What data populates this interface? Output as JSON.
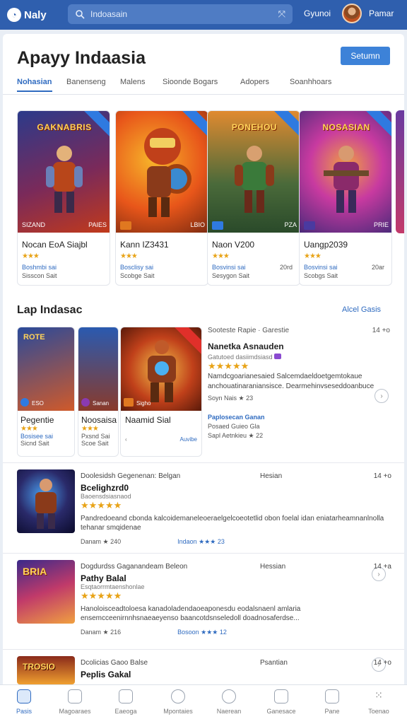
{
  "topbar": {
    "logo": "Naly",
    "search_query": "Indoasain",
    "link": "Gyunoi",
    "user": "Pamar"
  },
  "header": {
    "title": "Apayy Indaasia",
    "button": "Setumn"
  },
  "tabs": [
    {
      "label": "Nohasian"
    },
    {
      "label": "Banenseng"
    },
    {
      "label": "Malens"
    },
    {
      "label": "Sioonde Bogars"
    },
    {
      "label": "Adopers"
    },
    {
      "label": "Soanhhoars"
    }
  ],
  "featured": [
    {
      "art": "GAKNABRIS",
      "name": "Nocan EoA Siajbl",
      "rating": "★★★",
      "meta1": "Boshmbi sai",
      "meta2": "Sisscon Sait",
      "badge_left": "SIZAND",
      "badge_right": "PAIES",
      "colors": [
        "#2b3a8a",
        "#c23a1a",
        "#f2a23a"
      ]
    },
    {
      "art": "",
      "name": "Kann IZ3431",
      "rating": "★★★",
      "meta1": "Bosclisy sai",
      "meta2": "Scobge Sait",
      "badge_left": "",
      "badge_right": "LBIO",
      "colors": [
        "#e8561a",
        "#f7b52a",
        "#7a2a10"
      ]
    },
    {
      "art": "PONEHOU",
      "name": "Naon V200",
      "rating": "★★★",
      "meta1": "Bosvinsi sai",
      "meta2": "Sesygon Sait",
      "badge_left": "",
      "badge_right": "PZA",
      "meta_right": "20rd",
      "colors": [
        "#3a6a3a",
        "#f0b030",
        "#a04020"
      ]
    },
    {
      "art": "NOSASIAN",
      "name": "Uangp2039",
      "rating": "★★★",
      "meta1": "Bosvinsi sai",
      "meta2": "Scobgs Sait",
      "badge_left": "",
      "badge_right": "PRIE",
      "meta_right": "20ar",
      "colors": [
        "#4a2a7a",
        "#c83aa0",
        "#f0a040"
      ]
    }
  ],
  "section": {
    "title": "Lap Indasac",
    "link": "Alcel Gasis"
  },
  "mid_cards": [
    {
      "name": "Pegentie",
      "rating": "★★★",
      "meta1": "Bosisee sai",
      "meta2": "Sicnd Sait",
      "badge": "ESO"
    },
    {
      "name": "Noosaisa",
      "rating": "★★★",
      "meta1": "Pxsnd Sai",
      "meta2": "Scoe Sait",
      "badge": "Sanan"
    },
    {
      "name": "Naamid Sial",
      "badge": "Sigho",
      "extra": "Auvibe"
    }
  ],
  "detail": {
    "dev": "Sooteste Rapie",
    "dev_right": "Garestie",
    "time": "14 +o",
    "name": "Nanetka Asnauden",
    "sub": "Gatutoed dasiimdsiasd",
    "rating": "★★★★★",
    "desc": "Namdcgoarianesaied Salcemdaeldoetgemtokaue anchouatinaraniansisce. Dearmehinvseseddoanbuce",
    "rating_line": "Soyn Nais ★ 23",
    "link": "Paplosecan Ganan",
    "link2": "Posaed Guieo Gla",
    "foot": "Sapl Aetnkieu ★ 22"
  },
  "list": [
    {
      "dev": "Doolesidsh Gegenenan: Belgan",
      "dev_right": "Hesian",
      "time": "14 +o",
      "name": "Bcelighzrd0",
      "sub": "Baoensdsiasnaod",
      "rating": "★★★★★",
      "desc": "Pandredoeand cbonda kalcoidemaneleoeraelgelcoeotetlid obon foelal idan eniatarheamnanlnolla tehanar smqidenae",
      "meta": "Danam ★ 240",
      "meta_right": "Indaon ★★★ 23"
    },
    {
      "dev": "Dogdurdss Gaganandeam Beleon",
      "dev_right": "Hessian",
      "time": "14 +a",
      "name": "Pathy Balal",
      "sub": "Esqtaorrmtaenshonlae",
      "rating": "★★★★★",
      "desc": "Hanoloisceadtoloesa kanadoladendaoeaponesdu eodalsnaenl amlaria ensemcceenirnnhsnaeaeyenso baancotdsnseledoll doadnosaferdse...",
      "meta": "Danam ★ 216",
      "meta_right": "Bosoon ★★★ 12"
    },
    {
      "dev": "Dcolicias Gaoo Balse",
      "dev_right": "Psantian",
      "time": "14 +o",
      "name": "Peplis Gakal",
      "sub": "",
      "rating": "",
      "desc": "",
      "meta": "",
      "meta_right": ""
    }
  ],
  "bottom_nav": [
    {
      "label": "Pasis"
    },
    {
      "label": "Magoaraes"
    },
    {
      "label": "Eaeoga"
    },
    {
      "label": "Mpontaies"
    },
    {
      "label": "Naerean"
    },
    {
      "label": "Ganesace"
    },
    {
      "label": "Pane"
    },
    {
      "label": "Toenao"
    }
  ]
}
